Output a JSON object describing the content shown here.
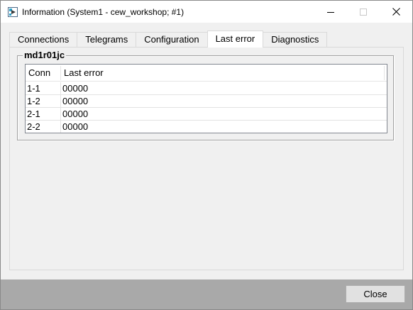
{
  "window": {
    "title": "Information (System1 - cew_workshop; #1)",
    "icon": "app-icon"
  },
  "tabs": [
    {
      "label": "Connections",
      "active": false
    },
    {
      "label": "Telegrams",
      "active": false
    },
    {
      "label": "Configuration",
      "active": false
    },
    {
      "label": "Last error",
      "active": true
    },
    {
      "label": "Diagnostics",
      "active": false
    }
  ],
  "group": {
    "title": "md1r01jc"
  },
  "grid": {
    "columns": [
      "Conn",
      "Last error"
    ],
    "rows": [
      {
        "conn": "1-1",
        "last_error": "00000"
      },
      {
        "conn": "1-2",
        "last_error": "00000"
      },
      {
        "conn": "2-1",
        "last_error": "00000"
      },
      {
        "conn": "2-2",
        "last_error": "00000"
      }
    ]
  },
  "footer": {
    "close_label": "Close"
  },
  "colors": {
    "titlebar": "#ffffff",
    "background": "#f0f0f0",
    "footer": "#a9a9a9",
    "button": "#e1e1e1"
  }
}
